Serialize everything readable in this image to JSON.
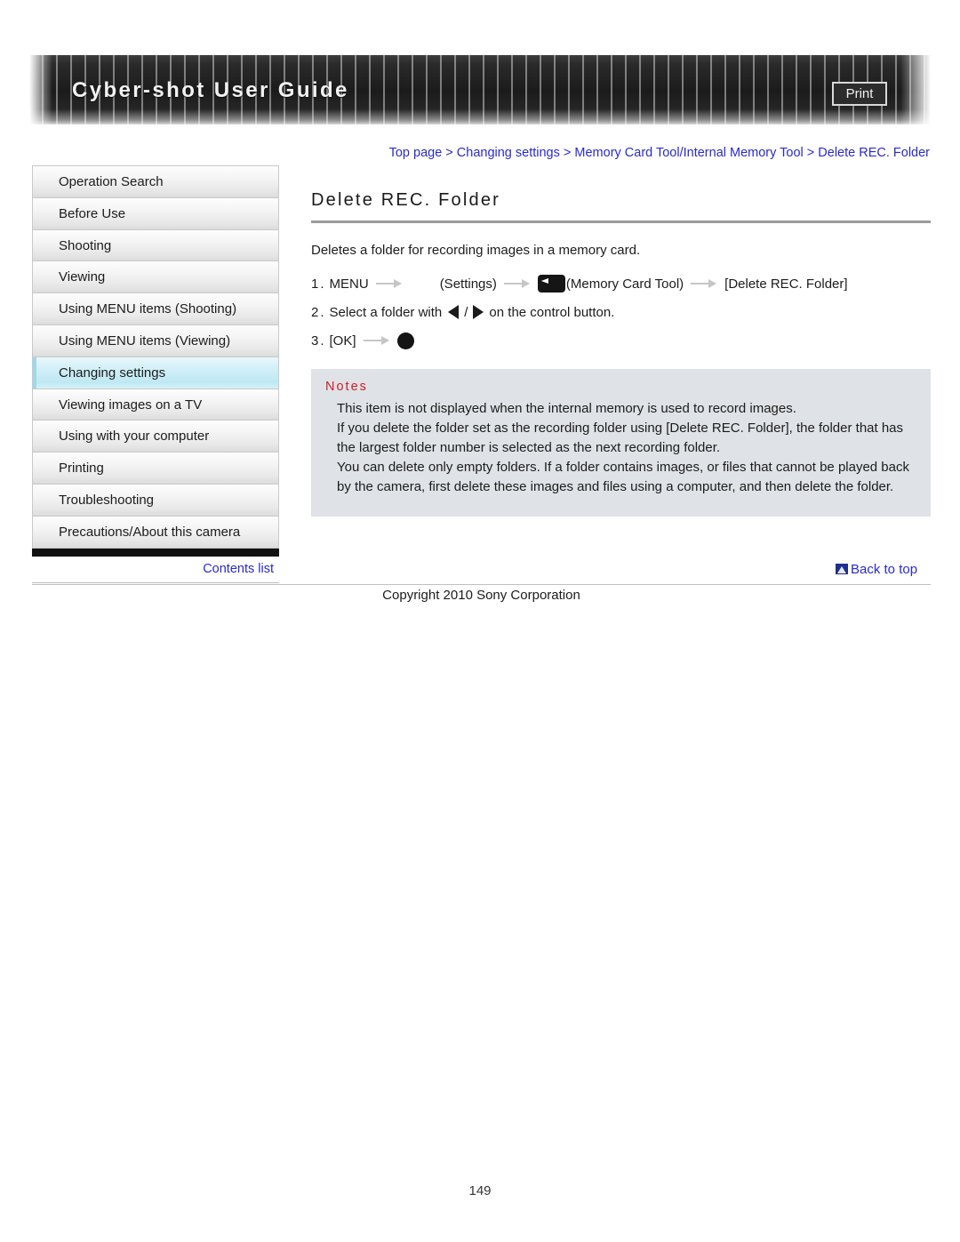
{
  "header": {
    "title": "Cyber-shot User Guide",
    "print_label": "Print"
  },
  "breadcrumb": {
    "items": [
      "Top page",
      "Changing settings",
      "Memory Card Tool/Internal Memory Tool",
      "Delete REC. Folder"
    ],
    "separator": ">",
    "color": "#2a2ad0"
  },
  "sidebar": {
    "items": [
      {
        "label": "Operation Search",
        "selected": false
      },
      {
        "label": "Before Use",
        "selected": false
      },
      {
        "label": "Shooting",
        "selected": false
      },
      {
        "label": "Viewing",
        "selected": false
      },
      {
        "label": "Using MENU items (Shooting)",
        "selected": false
      },
      {
        "label": "Using MENU items (Viewing)",
        "selected": false
      },
      {
        "label": "Changing settings",
        "selected": true
      },
      {
        "label": "Viewing images on a TV",
        "selected": false
      },
      {
        "label": "Using with your computer",
        "selected": false
      },
      {
        "label": "Printing",
        "selected": false
      },
      {
        "label": "Troubleshooting",
        "selected": false
      },
      {
        "label": "Precautions/About this camera",
        "selected": false
      }
    ],
    "contents_list_label": "Contents list",
    "selected_color": "#bfe8f3"
  },
  "main": {
    "title": "Delete REC. Folder",
    "intro": "Deletes a folder for recording images in a memory card.",
    "steps": {
      "step1": {
        "number": "1.",
        "menu_label": "MENU",
        "settings_label": "(Settings)",
        "memory_card_tool_label": "(Memory Card Tool)",
        "target_label": "[Delete REC. Folder]",
        "settings_icon": "settings-toolbox-icon",
        "memory_card_icon": "memory-card-icon"
      },
      "step2": {
        "number": "2.",
        "text_before": "Select a folder with",
        "slash": "/",
        "text_after": "on the control button.",
        "left_icon": "triangle-left-icon",
        "right_icon": "triangle-right-icon"
      },
      "step3": {
        "number": "3.",
        "ok_label": "[OK]",
        "dot_icon": "center-button-icon"
      }
    },
    "notes": {
      "title": "Notes",
      "lines": [
        "This item is not displayed when the internal memory is used to record images.",
        "If you delete the folder set as the recording folder using [Delete REC. Folder], the folder that has the largest folder number is selected as the next recording folder.",
        "You can delete only empty folders. If a folder contains images, or files that cannot be played back by the camera, first delete these images and files using a computer, and then delete the folder."
      ],
      "title_color": "#cf1f28",
      "background_color": "#dfe2e6"
    }
  },
  "footer": {
    "back_to_top_label": "Back to top",
    "back_to_top_icon": "back-to-top-icon",
    "copyright": "Copyright 2010 Sony Corporation",
    "page_number": "149"
  }
}
